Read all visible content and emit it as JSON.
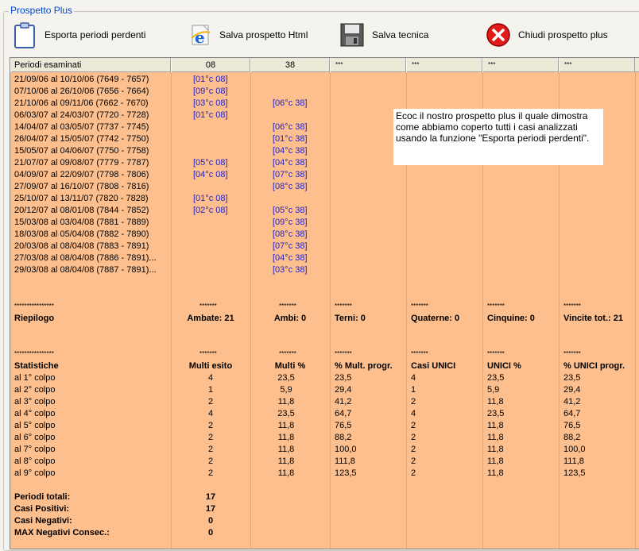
{
  "window": {
    "group_title": "Prospetto Plus"
  },
  "toolbar": {
    "export_label": "Esporta periodi perdenti",
    "save_html_label": "Salva prospetto Html",
    "save_tech_label": "Salva tecnica",
    "close_label": "Chiudi prospetto plus"
  },
  "columns": [
    "Periodi esaminati",
    "08",
    "38",
    "***",
    "***",
    "***",
    "***"
  ],
  "periods": [
    {
      "p": "21/09/06 al 10/10/06  (7649 - 7657)",
      "c08": "[01°c 08]",
      "c38": ""
    },
    {
      "p": "07/10/06 al 26/10/06  (7656 - 7664)",
      "c08": "[09°c 08]",
      "c38": ""
    },
    {
      "p": "21/10/06 al 09/11/06  (7662 - 7670)",
      "c08": "[03°c 08]",
      "c38": "[06°c 38]"
    },
    {
      "p": "06/03/07 al 24/03/07  (7720 - 7728)",
      "c08": "[01°c 08]",
      "c38": ""
    },
    {
      "p": "14/04/07 al 03/05/07  (7737 - 7745)",
      "c08": "",
      "c38": "[06°c 38]"
    },
    {
      "p": "26/04/07 al 15/05/07  (7742 - 7750)",
      "c08": "",
      "c38": "[01°c 38]"
    },
    {
      "p": "15/05/07 al 04/06/07  (7750 - 7758)",
      "c08": "",
      "c38": "[04°c 38]"
    },
    {
      "p": "21/07/07 al 09/08/07  (7779 - 7787)",
      "c08": "[05°c 08]",
      "c38": "[04°c 38]"
    },
    {
      "p": "04/09/07 al 22/09/07  (7798 - 7806)",
      "c08": "[04°c 08]",
      "c38": "[07°c 38]"
    },
    {
      "p": "27/09/07 al 16/10/07  (7808 - 7816)",
      "c08": "",
      "c38": "[08°c 38]"
    },
    {
      "p": "25/10/07 al 13/11/07  (7820 - 7828)",
      "c08": "[01°c 08]",
      "c38": ""
    },
    {
      "p": "20/12/07 al 08/01/08  (7844 - 7852)",
      "c08": "[02°c 08]",
      "c38": "[05°c 38]"
    },
    {
      "p": "15/03/08 al 03/04/08  (7881 - 7889)",
      "c08": "",
      "c38": "[09°c 38]"
    },
    {
      "p": "18/03/08 al 05/04/08  (7882 - 7890)",
      "c08": "",
      "c38": "[08°c 38]"
    },
    {
      "p": "20/03/08 al 08/04/08  (7883 - 7891)",
      "c08": "",
      "c38": "[07°c 38]"
    },
    {
      "p": "27/03/08 al 08/04/08  (7886 - 7891)...",
      "c08": "",
      "c38": "[04°c 38]"
    },
    {
      "p": "29/03/08 al 08/04/08  (7887 - 7891)...",
      "c08": "",
      "c38": "[03°c 38]"
    }
  ],
  "separator1": [
    "****************",
    "*******",
    "*******",
    "*******",
    "*******",
    "*******",
    "*******"
  ],
  "riepilogo": [
    "Riepilogo",
    "Ambate: 21",
    "Ambi: 0",
    "Terni: 0",
    "Quaterne: 0",
    "Cinquine: 0",
    "Vincite tot.: 21"
  ],
  "separator2": [
    "****************",
    "*******",
    "*******",
    "*******",
    "*******",
    "*******",
    "*******"
  ],
  "stats_header": [
    "Statistiche",
    "Multi esito",
    "Multi %",
    "% Mult. progr.",
    "Casi UNICI",
    "UNICI %",
    "% UNICI progr."
  ],
  "stats": [
    [
      "al 1° colpo",
      "4",
      "23,5",
      "23,5",
      "4",
      "23,5",
      "23,5"
    ],
    [
      "al 2° colpo",
      "1",
      "5,9",
      "29,4",
      "1",
      "5,9",
      "29,4"
    ],
    [
      "al 3° colpo",
      "2",
      "11,8",
      "41,2",
      "2",
      "11,8",
      "41,2"
    ],
    [
      "al 4° colpo",
      "4",
      "23,5",
      "64,7",
      "4",
      "23,5",
      "64,7"
    ],
    [
      "al 5° colpo",
      "2",
      "11,8",
      "76,5",
      "2",
      "11,8",
      "76,5"
    ],
    [
      "al 6° colpo",
      "2",
      "11,8",
      "88,2",
      "2",
      "11,8",
      "88,2"
    ],
    [
      "al 7° colpo",
      "2",
      "11,8",
      "100,0",
      "2",
      "11,8",
      "100,0"
    ],
    [
      "al 8° colpo",
      "2",
      "11,8",
      "111,8",
      "2",
      "11,8",
      "111,8"
    ],
    [
      "al 9° colpo",
      "2",
      "11,8",
      "123,5",
      "2",
      "11,8",
      "123,5"
    ]
  ],
  "totals": [
    {
      "label": "Periodi totali:",
      "value": "17"
    },
    {
      "label": "Casi Positivi:",
      "value": "17"
    },
    {
      "label": "Casi Negativi:",
      "value": "0"
    },
    {
      "label": "MAX Negativi Consec.:",
      "value": "0"
    }
  ],
  "note": {
    "line1": "Ecoc il nostro prospetto plus il quale dimostra",
    "line2": "come abbiamo coperto tutti i casi analizzati",
    "line3": "usando la funzione \"Esporta periodi perdenti\"."
  }
}
